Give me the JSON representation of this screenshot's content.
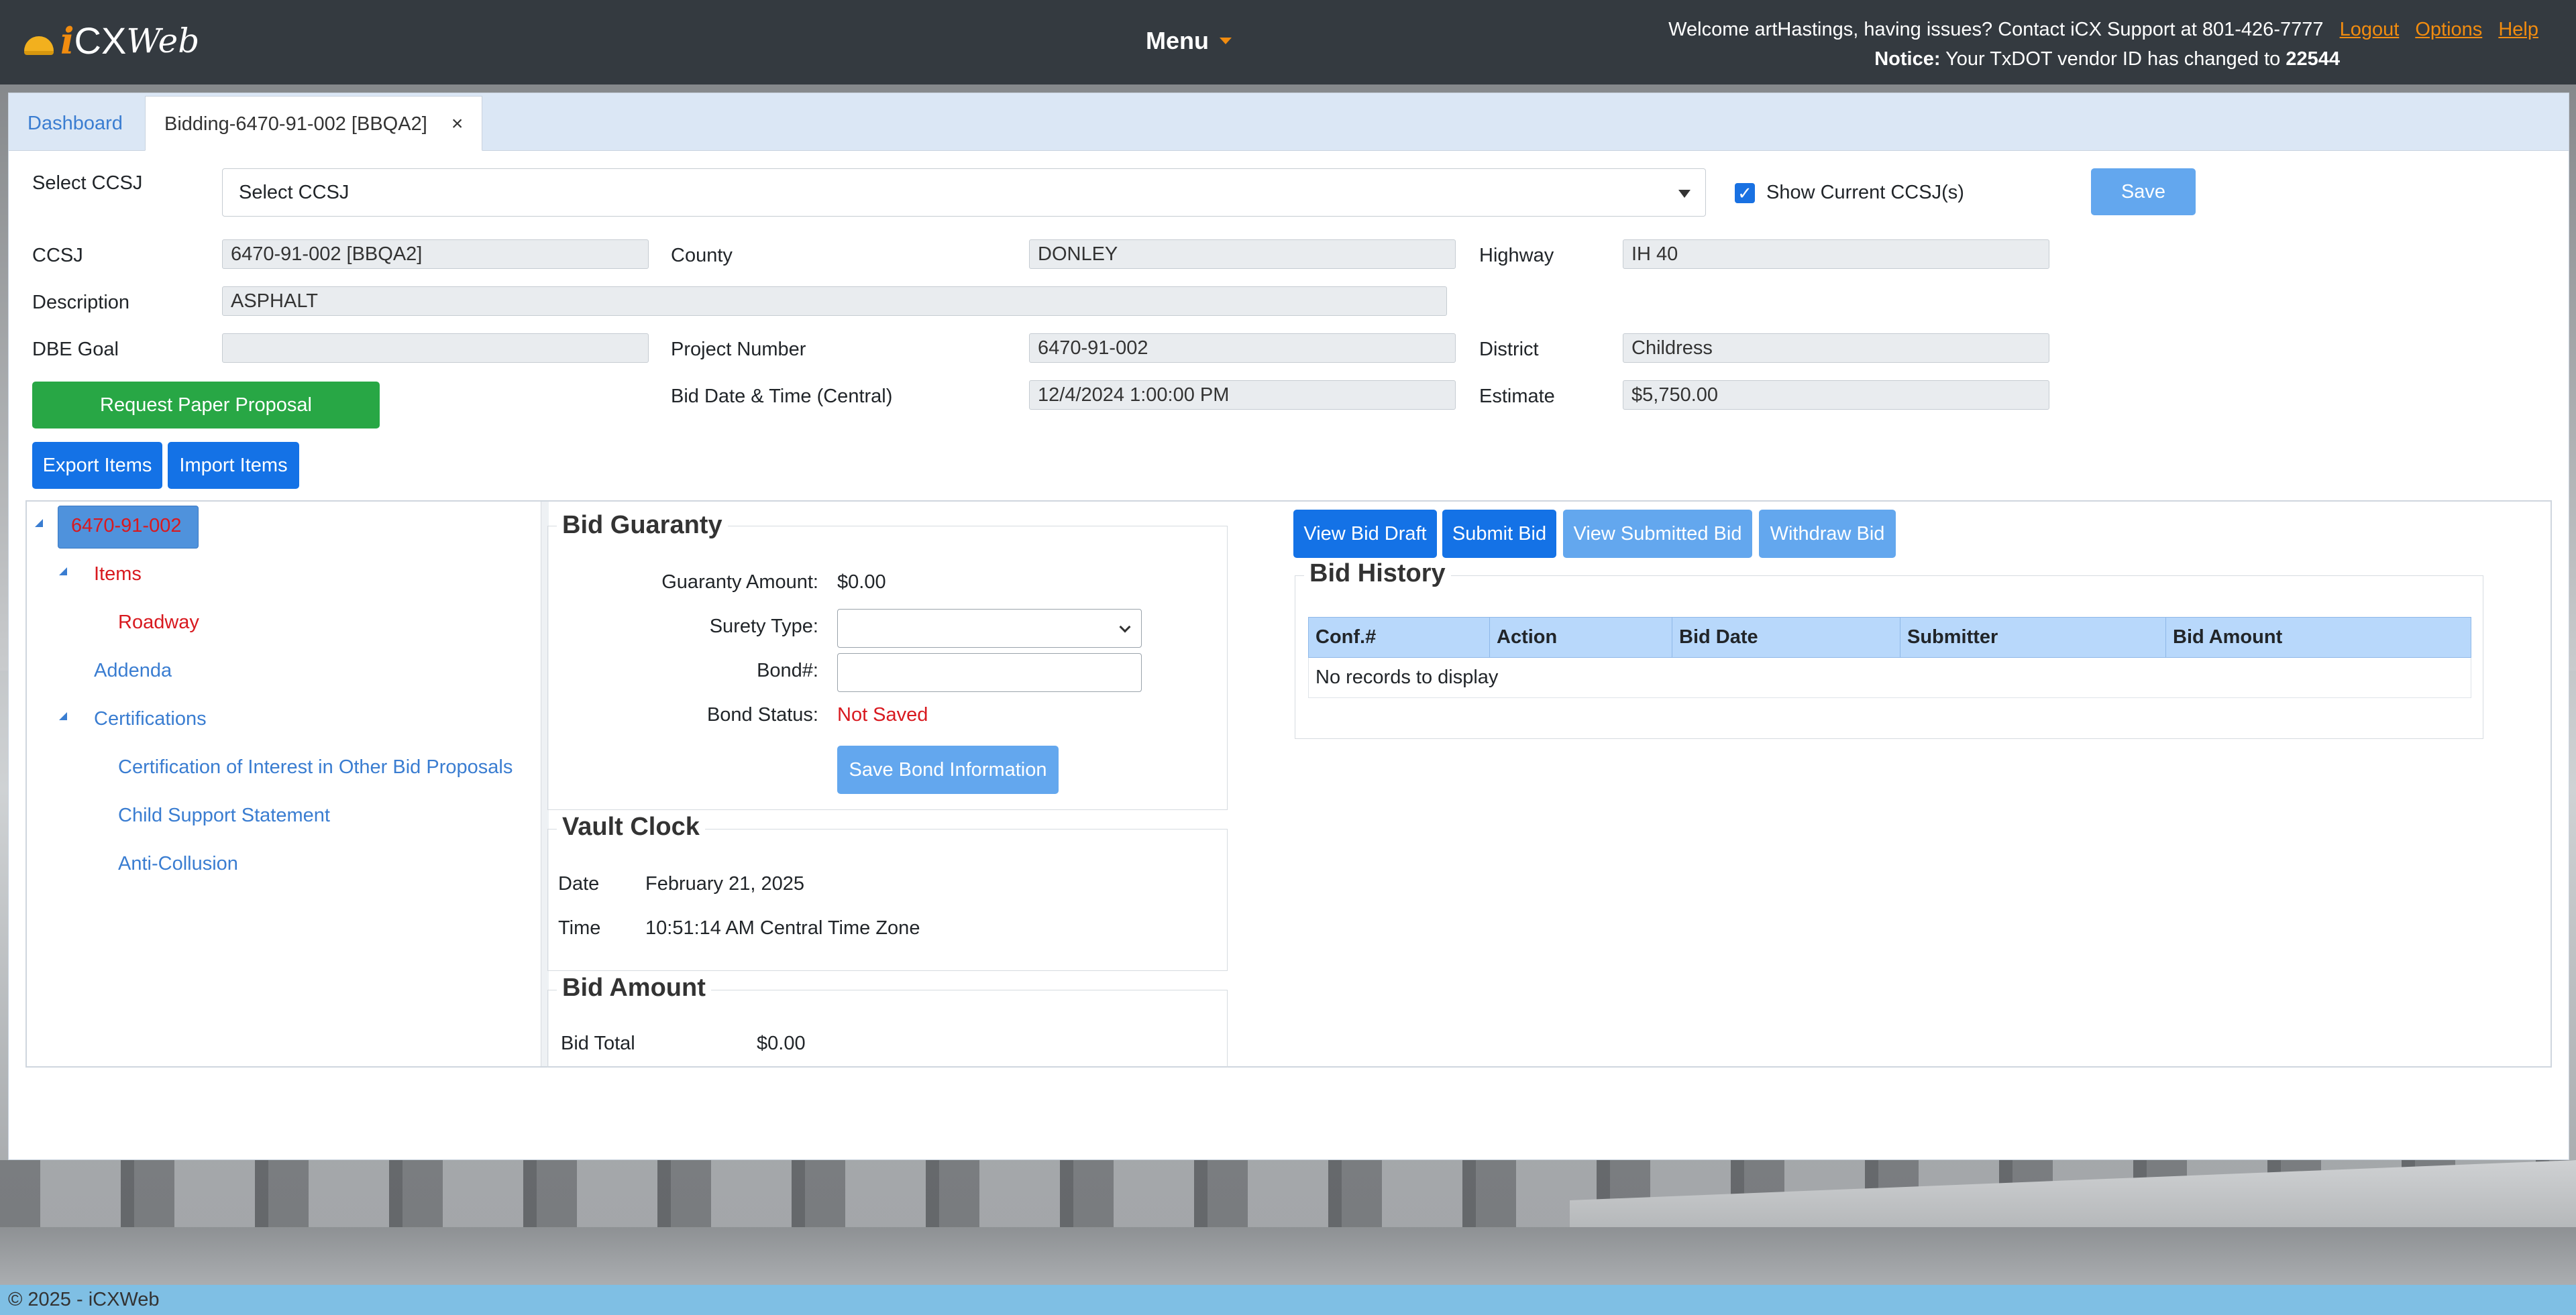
{
  "app": {
    "brand_i": "i",
    "brand_cx": "CX",
    "brand_web": "Web",
    "menu_label": "Menu",
    "welcome_text": "Welcome artHastings, having issues? Contact iCX Support at 801-426-7777",
    "links": {
      "logout": "Logout",
      "options": "Options",
      "help": "Help"
    },
    "notice_label": "Notice:",
    "notice_text": "Your TxDOT vendor ID has changed to",
    "notice_value": "22544",
    "accent_color": "#f28c0f"
  },
  "tabs": [
    {
      "label": "Dashboard"
    },
    {
      "label": "Bidding-6470-91-002 [BBQA2]",
      "close": "×"
    }
  ],
  "header_form": {
    "select_ccsj_label": "Select CCSJ",
    "select_ccsj_value": "Select CCSJ",
    "show_current_label": "Show Current CCSJ(s)",
    "show_current_checked": true,
    "save_label": "Save",
    "ccsj_label": "CCSJ",
    "ccsj_value": "6470-91-002 [BBQA2]",
    "county_label": "County",
    "county_value": "DONLEY",
    "highway_label": "Highway",
    "highway_value": "IH 40",
    "description_label": "Description",
    "description_value": "ASPHALT",
    "dbe_goal_label": "DBE Goal",
    "dbe_goal_value": "",
    "project_number_label": "Project Number",
    "project_number_value": "6470-91-002",
    "district_label": "District",
    "district_value": "Childress",
    "bid_date_label": "Bid Date & Time (Central)",
    "bid_date_value": "12/4/2024 1:00:00 PM",
    "estimate_label": "Estimate",
    "estimate_value": "$5,750.00",
    "request_paper_label": "Request Paper Proposal",
    "export_items_label": "Export Items",
    "import_items_label": "Import Items"
  },
  "tree": {
    "root": "6470-91-002",
    "items": "Items",
    "roadway": "Roadway",
    "addenda": "Addenda",
    "certifications": "Certifications",
    "cert_interest": "Certification of Interest in Other Bid Proposals",
    "child_support": "Child Support Statement",
    "anti_collusion": "Anti-Collusion"
  },
  "bid_guaranty": {
    "title": "Bid Guaranty",
    "guaranty_amount_label": "Guaranty Amount:",
    "guaranty_amount_value": "$0.00",
    "surety_type_label": "Surety Type:",
    "surety_type_value": "",
    "bond_no_label": "Bond#:",
    "bond_no_value": "",
    "bond_status_label": "Bond Status:",
    "bond_status_value": "Not Saved",
    "save_bond_label": "Save Bond Information"
  },
  "vault_clock": {
    "title": "Vault Clock",
    "date_label": "Date",
    "date_value": "February 21, 2025",
    "time_label": "Time",
    "time_value": "10:51:14 AM Central Time Zone"
  },
  "bid_amount": {
    "title": "Bid Amount",
    "bid_total_label": "Bid Total",
    "bid_total_value": "$0.00"
  },
  "bid_actions": {
    "view_draft": "View Bid Draft",
    "submit": "Submit Bid",
    "view_submitted": "View Submitted Bid",
    "withdraw": "Withdraw Bid"
  },
  "bid_history": {
    "title": "Bid History",
    "columns": [
      "Conf.#",
      "Action",
      "Bid Date",
      "Submitter",
      "Bid Amount"
    ],
    "empty_text": "No records to display"
  },
  "footer": {
    "text": "© 2025 - iCXWeb"
  }
}
